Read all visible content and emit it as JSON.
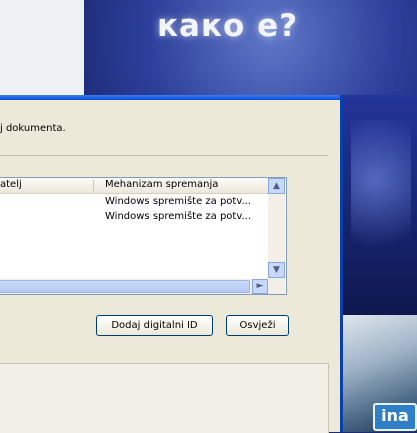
{
  "background": {
    "banner_text": "како е?",
    "brand_text": "ina"
  },
  "dialog": {
    "intro": "j dokumenta.",
    "list": {
      "columns": [
        "atelj",
        "Mehanizam spremanja"
      ],
      "rows": [
        {
          "storage": "Windows spremište za potv..."
        },
        {
          "storage": "Windows spremište za potv..."
        }
      ]
    },
    "buttons": {
      "add_digital_id": "Dodaj digitalni ID",
      "refresh": "Osvježi"
    }
  }
}
